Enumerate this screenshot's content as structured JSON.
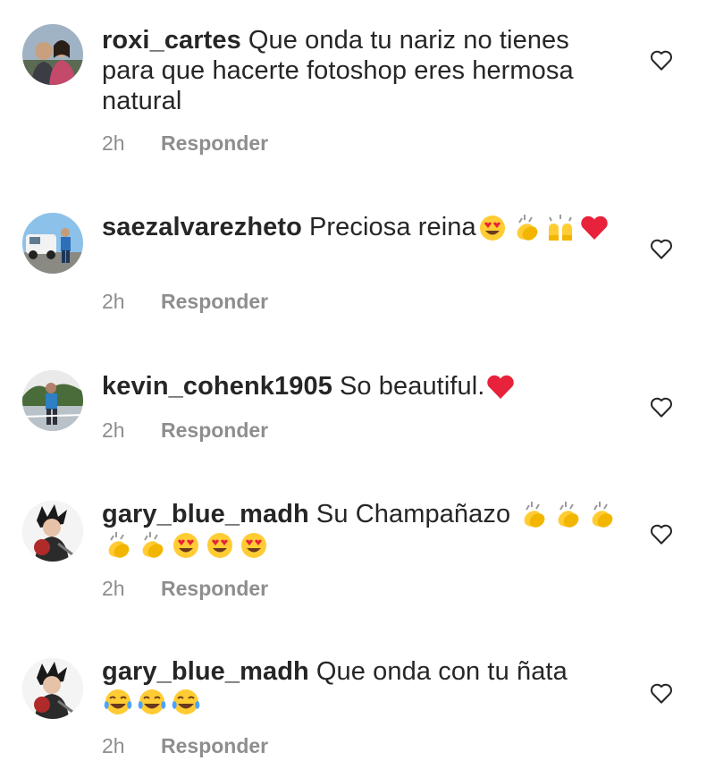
{
  "comments": [
    {
      "username": "roxi_cartes",
      "text": "Que onda tu nariz no tienes para que hacerte fotoshop eres hermosa natural",
      "emojis": [],
      "time": "2h",
      "reply_label": "Responder",
      "avatar_icon": "couple-photo-avatar",
      "like_icon": "heart-outline-icon"
    },
    {
      "username": "saezalvarezheto",
      "text": "Preciosa reina",
      "emojis": [
        "heart-eyes-emoji",
        "clapping-hands-emoji",
        "raising-hands-emoji",
        "red-heart-emoji"
      ],
      "time": "2h",
      "reply_label": "Responder",
      "avatar_icon": "person-with-car-avatar",
      "like_icon": "heart-outline-icon"
    },
    {
      "username": "kevin_cohenk1905",
      "text": "So beautiful.",
      "emojis": [
        "red-heart-emoji"
      ],
      "time": "2h",
      "reply_label": "Responder",
      "avatar_icon": "person-outdoors-avatar",
      "like_icon": "heart-outline-icon"
    },
    {
      "username": "gary_blue_madh",
      "text": "Su Champañazo",
      "emojis": [
        "clapping-hands-emoji",
        "clapping-hands-emoji",
        "clapping-hands-emoji",
        "clapping-hands-emoji",
        "clapping-hands-emoji",
        "heart-eyes-emoji",
        "heart-eyes-emoji",
        "heart-eyes-emoji"
      ],
      "time": "2h",
      "reply_label": "Responder",
      "avatar_icon": "anime-character-avatar",
      "like_icon": "heart-outline-icon"
    },
    {
      "username": "gary_blue_madh",
      "text": "Que onda con tu ñata",
      "emojis": [
        "tears-of-joy-emoji",
        "tears-of-joy-emoji",
        "tears-of-joy-emoji"
      ],
      "time": "2h",
      "reply_label": "Responder",
      "avatar_icon": "anime-character-avatar",
      "like_icon": "heart-outline-icon"
    }
  ]
}
